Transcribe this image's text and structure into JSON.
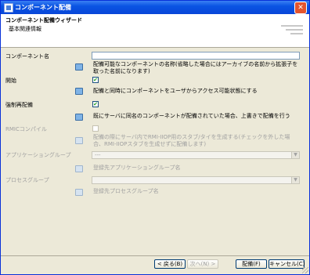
{
  "window": {
    "title": "コンポーネント配備"
  },
  "header": {
    "title": "コンポーネント配備ウィザード",
    "subtitle": "基本関連情報"
  },
  "form": {
    "component_name": {
      "label": "コンポーネント名",
      "value": "",
      "help": "配備可能なコンポーネントの名称(省略した場合にはアーカイブの名前から拡張子を取った名前になります)"
    },
    "start": {
      "label": "開始",
      "checked": true,
      "help": "配備と同時にコンポーネントをユーザからアクセス可能状態にする"
    },
    "force_redeploy": {
      "label": "強制再配備",
      "checked": true,
      "help": "既にサーバに同名のコンポーネントが配備されていた場合、上書きで配備を行う"
    },
    "rmic_compile": {
      "label": "RMICコンパイル",
      "checked": false,
      "help_line1": "配備の際にサーバ内でRMI-IIOP用のスタブ/タイを生成する(チェックを外した場",
      "help_line2": "合、RMI-IIOPスタブを生成せずに配備します)"
    },
    "application_group": {
      "label": "アプリケーショングループ",
      "value": "---",
      "help": "登録先アプリケーショングループ名"
    },
    "process_group": {
      "label": "プロセスグループ",
      "value": "",
      "help": "登録先プロセスグループ名"
    }
  },
  "buttons": {
    "back": "< 戻る(B)",
    "next": "次へ(N) >",
    "finish": "配備(F)",
    "cancel": "キャンセル(C)"
  },
  "icons": {
    "close": "close-icon",
    "help": "book-icon",
    "window": "window-icon"
  },
  "colors": {
    "titlebar": "#0a54e3",
    "dialog_bg": "#ece9d8",
    "disabled_text": "#a0a0a0"
  }
}
